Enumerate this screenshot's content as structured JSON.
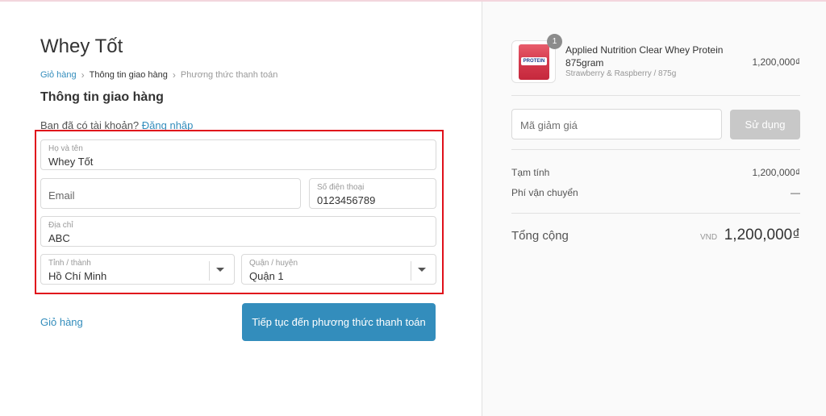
{
  "store": {
    "title": "Whey Tốt"
  },
  "breadcrumb": {
    "cart": "Giỏ hàng",
    "shipping": "Thông tin giao hàng",
    "payment": "Phương thức thanh toán"
  },
  "section": {
    "title": "Thông tin giao hàng"
  },
  "login": {
    "prompt": "Bạn đã có tài khoản?",
    "link": "Đăng nhập"
  },
  "form": {
    "fullname": {
      "label": "Họ và tên",
      "value": "Whey Tốt"
    },
    "email": {
      "placeholder": "Email"
    },
    "phone": {
      "label": "Số điện thoại",
      "value": "0123456789"
    },
    "address": {
      "label": "Địa chỉ",
      "value": "ABC"
    },
    "province": {
      "label": "Tỉnh / thành",
      "value": "Hồ Chí Minh"
    },
    "district": {
      "label": "Quận / huyện",
      "value": "Quận 1"
    }
  },
  "actions": {
    "back": "Giỏ hàng",
    "continue": "Tiếp tục đến phương thức thanh toán"
  },
  "order": {
    "item": {
      "quantity": "1",
      "name": "Applied Nutrition Clear Whey Protein 875gram",
      "variant": "Strawberry & Raspberry / 875g",
      "price": "1,200,000₫",
      "image_label": "PROTEIN"
    },
    "discount": {
      "placeholder": "Mã giảm giá",
      "button": "Sử dụng"
    },
    "subtotal": {
      "label": "Tạm tính",
      "value": "1,200,000₫"
    },
    "shipping": {
      "label": "Phí vận chuyển",
      "value": "—"
    },
    "total": {
      "label": "Tổng cộng",
      "currency": "VND",
      "value": "1,200,000₫"
    }
  },
  "colors": {
    "accent": "#338dbc",
    "highlight": "#e0101b",
    "disabled_button": "#c8c8c8"
  }
}
